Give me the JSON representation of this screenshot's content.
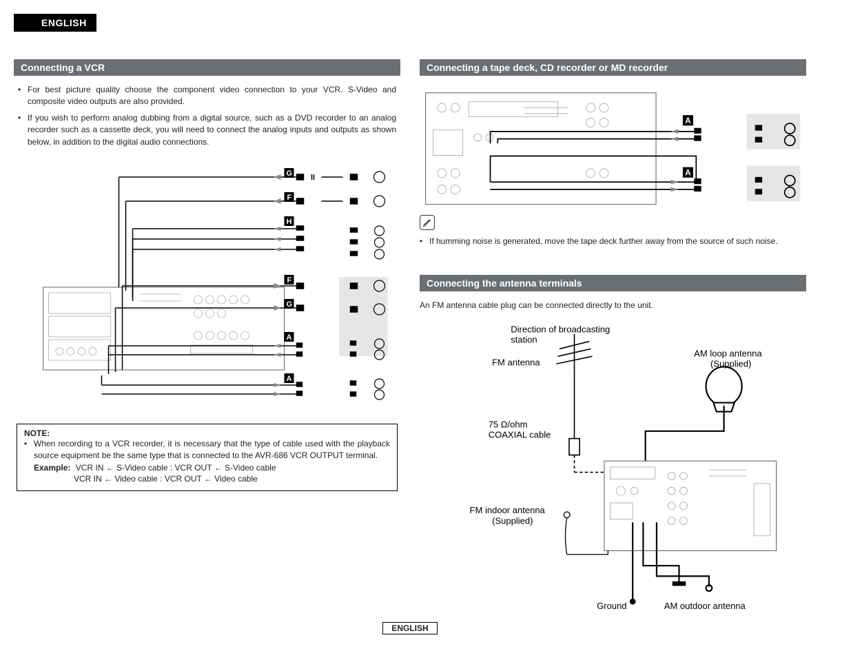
{
  "lang_tab": "ENGLISH",
  "footer": "ENGLISH",
  "left": {
    "header": "Connecting a VCR",
    "bullets": [
      "For best picture quality choose the component video connection to your VCR. S-Video and composite video outputs are also provided.",
      "If you wish to perform analog dubbing from a digital source, such as a DVD recorder to an analog recorder such as a cassette deck, you will need to connect the analog inputs and outputs as shown below, in addition to the digital audio connections."
    ],
    "diagram_labels": [
      "G",
      "F",
      "H",
      "F",
      "G",
      "A",
      "A"
    ],
    "note_label": "NOTE:",
    "note_text": "When recording to a VCR recorder, it is necessary that the type of cable used with the playback source equipment be the same type that is connected to the AVR-686 VCR OUTPUT terminal.",
    "example_label": "Example:",
    "example_lines": [
      "VCR IN ← S-Video cable : VCR OUT ← S-Video cable",
      "VCR IN ← Video cable : VCR OUT ← Video cable"
    ]
  },
  "right": {
    "header1": "Connecting a tape deck, CD recorder or MD recorder",
    "tape_labels": [
      "A",
      "A"
    ],
    "pencil_note": "If humming noise is generated, move the tape deck further away from the source of such noise.",
    "header2": "Connecting the antenna terminals",
    "antenna_para": "An FM antenna cable plug can be connected directly to the unit.",
    "antenna_labels": {
      "direction": "Direction of broadcasting station",
      "fm_antenna": "FM antenna",
      "am_loop": "AM loop antenna (Supplied)",
      "coax": "75 Ω/ohm COAXIAL cable",
      "fm_indoor": "FM indoor antenna (Supplied)",
      "ground": "Ground",
      "am_outdoor": "AM outdoor antenna"
    }
  }
}
